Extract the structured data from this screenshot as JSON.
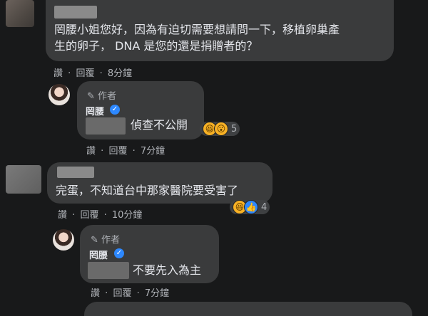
{
  "comments": [
    {
      "text_line1": "罔腰小姐您好，因為有迫切需要想請問一下，移植卵巢產",
      "text_line2": "生的卵子， DNA 是您的還是捐贈者的？",
      "actions": {
        "like": "讚",
        "dot": "·",
        "reply": "回覆",
        "time": "8分鐘"
      }
    },
    {
      "author_tag": "作者",
      "name": "罔腰",
      "text": "偵查不公開",
      "reaction_count": "5",
      "actions": {
        "like": "讚",
        "dot": "·",
        "reply": "回覆",
        "time": "7分鐘"
      }
    },
    {
      "text": "完蛋，不知道台中那家醫院要受害了",
      "reaction_count": "4",
      "actions": {
        "like": "讚",
        "dot": "·",
        "reply": "回覆",
        "time": "10分鐘"
      }
    },
    {
      "author_tag": "作者",
      "name": "罔腰",
      "text": "不要先入為主",
      "actions": {
        "like": "讚",
        "dot": "·",
        "reply": "回覆",
        "time": "7分鐘"
      }
    }
  ],
  "icons": {
    "pencil": "pencil-icon",
    "verified": "verified-badge-icon",
    "haha": "haha-reaction-icon",
    "wow": "wow-reaction-icon",
    "like": "like-reaction-icon"
  },
  "colors": {
    "background": "#18191a",
    "bubble": "#3a3b3c",
    "verified": "#2d88ff",
    "secondary_text": "#b0b3b8"
  }
}
